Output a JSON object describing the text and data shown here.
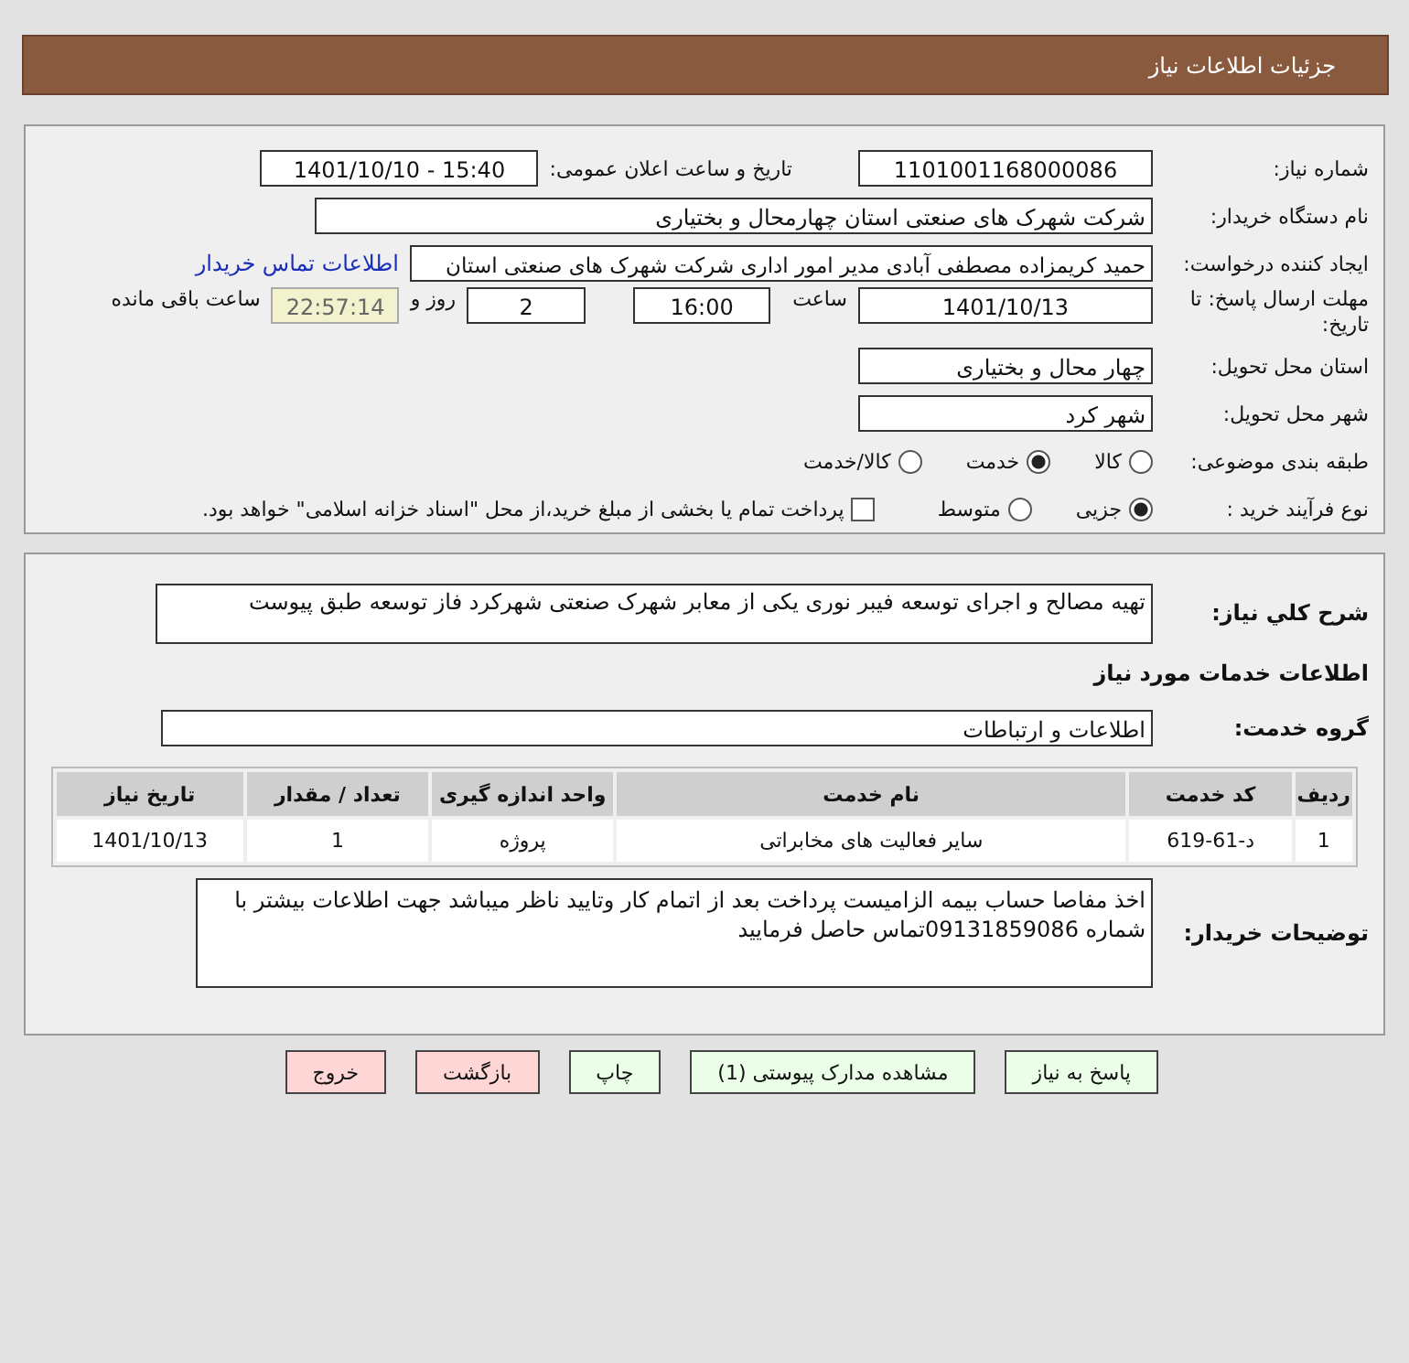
{
  "header": {
    "title": "جزئیات اطلاعات نیاز"
  },
  "need_number": {
    "label": "شماره نیاز:",
    "value": "1101001168000086"
  },
  "announce": {
    "label": "تاریخ و ساعت اعلان عمومی:",
    "value": "1401/10/10 - 15:40"
  },
  "buyer": {
    "label": "نام دستگاه خریدار:",
    "value": "شرکت شهرک های صنعتی استان چهارمحال و بختیاری"
  },
  "requester": {
    "label": "ایجاد کننده درخواست:",
    "value": "حمید کریمزاده مصطفی آبادی مدیر امور اداری شرکت شهرک های صنعتی استان",
    "link": "اطلاعات تماس خریدار"
  },
  "deadline": {
    "label": "مهلت ارسال پاسخ: تا تاریخ:",
    "date": "1401/10/13",
    "time_label": "ساعت",
    "time": "16:00",
    "days": "2",
    "days_label": "روز و",
    "remaining": "22:57:14",
    "remaining_label": "ساعت باقی مانده"
  },
  "province": {
    "label": "استان محل تحویل:",
    "value": "چهار محال و بختیاری"
  },
  "city": {
    "label": "شهر محل تحویل:",
    "value": "شهر کرد"
  },
  "category": {
    "label": "طبقه بندی موضوعی:",
    "options": [
      {
        "label": "کالا",
        "selected": false
      },
      {
        "label": "خدمت",
        "selected": true
      },
      {
        "label": "کالا/خدمت",
        "selected": false
      }
    ]
  },
  "process": {
    "label": "نوع فرآیند خرید :",
    "options": [
      {
        "label": "جزیی",
        "selected": true
      },
      {
        "label": "متوسط",
        "selected": false
      }
    ],
    "payment": {
      "checked": false,
      "text": "پرداخت تمام یا بخشی از مبلغ خرید،از محل \"اسناد خزانه اسلامی\" خواهد بود."
    }
  },
  "description": {
    "label": "شرح کلي نياز:",
    "value": "تهیه مصالح و اجرای توسعه فیبر نوری یکی از معابر شهرک صنعتی شهرکرد فاز توسعه طبق پیوست"
  },
  "services_title": "اطلاعات خدمات مورد نیاز",
  "service_group": {
    "label": "گروه خدمت:",
    "value": "اطلاعات و ارتباطات"
  },
  "table": {
    "columns": [
      "ردیف",
      "کد خدمت",
      "نام خدمت",
      "واحد اندازه گیری",
      "تعداد / مقدار",
      "تاریخ نیاز"
    ],
    "rows": [
      [
        "1",
        "د-61-619",
        "سایر فعالیت های مخابراتی",
        "پروژه",
        "1",
        "1401/10/13"
      ]
    ]
  },
  "buyer_notes": {
    "label": "توضیحات خریدار:",
    "value": "اخذ مفاصا حساب بیمه الزامیست پرداخت بعد از اتمام کار وتایید ناظر میباشد جهت اطلاعات بیشتر با شماره 09131859086تماس حاصل فرمایید"
  },
  "buttons": [
    {
      "label": "پاسخ به نیاز",
      "kind": "action"
    },
    {
      "label": "مشاهده مدارک پیوستی (1)",
      "kind": "action"
    },
    {
      "label": "چاپ",
      "kind": "action"
    },
    {
      "label": "بازگشت",
      "kind": "exit"
    },
    {
      "label": "خروج",
      "kind": "exit"
    }
  ]
}
